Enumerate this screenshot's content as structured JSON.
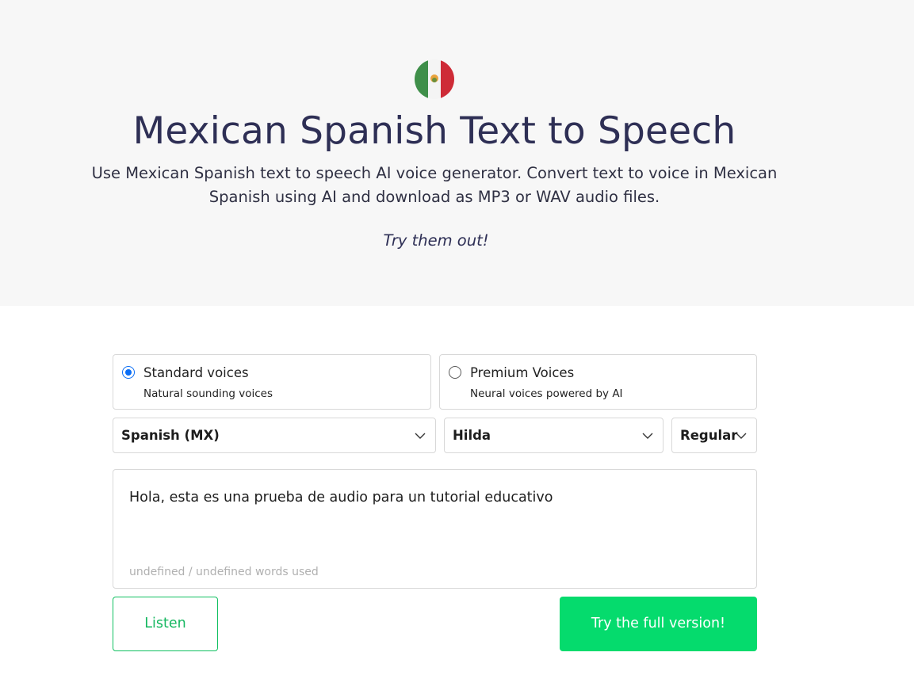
{
  "hero": {
    "flag_icon": "mexico-flag-icon",
    "title": "Mexican Spanish Text to Speech",
    "subtitle": "Use Mexican Spanish text to speech AI voice generator. Convert text to voice in Mexican Spanish using AI and download as MP3 or WAV audio files.",
    "tagline": "Try them out!"
  },
  "voice_types": [
    {
      "title": "Standard voices",
      "subtitle": "Natural sounding voices",
      "selected": true
    },
    {
      "title": "Premium Voices",
      "subtitle": "Neural voices powered by AI",
      "selected": false
    }
  ],
  "selects": {
    "language": "Spanish (MX)",
    "voice": "Hilda",
    "style": "Regular"
  },
  "editor": {
    "text": "Hola, esta es una prueba de audio para un tutorial educativo",
    "word_count": "undefined / undefined words used"
  },
  "buttons": {
    "listen": "Listen",
    "full_version": "Try the full version!"
  },
  "colors": {
    "accent_green": "#05db6d",
    "radio_blue": "#0b6ef5",
    "title_color": "#2e2f55"
  }
}
